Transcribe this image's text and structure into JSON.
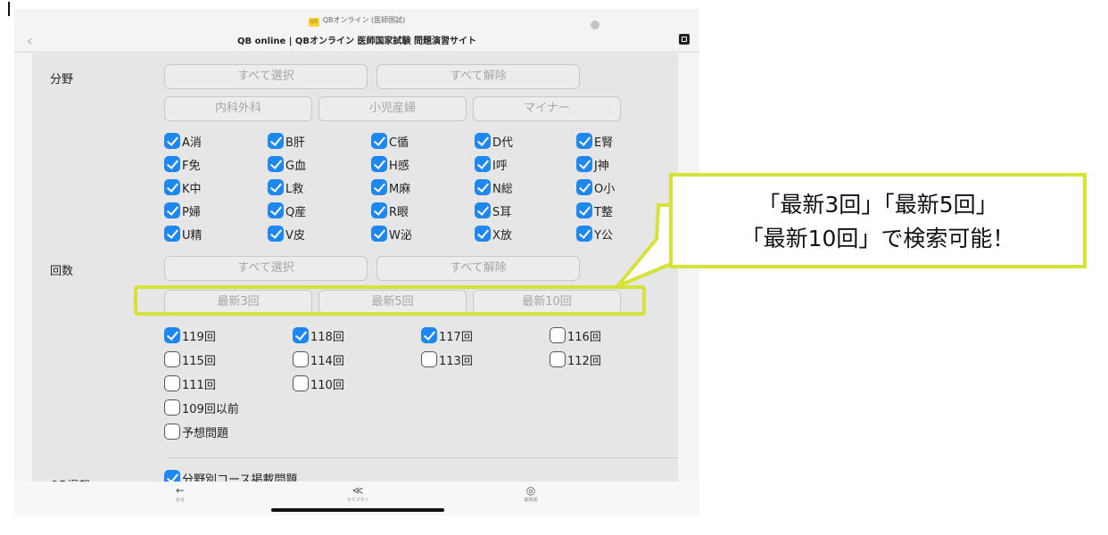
{
  "browser": {
    "status_title": "QBオンライン (医師国試)",
    "app_badge": "QB",
    "page_title": "QB online | QBオンライン 医師国家試験 問題演習サイト",
    "back_glyph": "‹"
  },
  "bunya": {
    "label": "分野",
    "select_all": "すべて選択",
    "deselect_all": "すべて解除",
    "groups": [
      "内科外科",
      "小児産婦",
      "マイナー"
    ],
    "items": [
      {
        "label": "A消",
        "checked": true
      },
      {
        "label": "B肝",
        "checked": true
      },
      {
        "label": "C循",
        "checked": true
      },
      {
        "label": "D代",
        "checked": true
      },
      {
        "label": "E腎",
        "checked": true
      },
      {
        "label": "F免",
        "checked": true
      },
      {
        "label": "G血",
        "checked": true
      },
      {
        "label": "H感",
        "checked": true
      },
      {
        "label": "I呼",
        "checked": true
      },
      {
        "label": "J神",
        "checked": true
      },
      {
        "label": "K中",
        "checked": true
      },
      {
        "label": "L救",
        "checked": true
      },
      {
        "label": "M麻",
        "checked": true
      },
      {
        "label": "N総",
        "checked": true
      },
      {
        "label": "O小",
        "checked": true
      },
      {
        "label": "P婦",
        "checked": true
      },
      {
        "label": "Q産",
        "checked": true
      },
      {
        "label": "R眼",
        "checked": true
      },
      {
        "label": "S耳",
        "checked": true
      },
      {
        "label": "T整",
        "checked": true
      },
      {
        "label": "U精",
        "checked": true
      },
      {
        "label": "V皮",
        "checked": true
      },
      {
        "label": "W泌",
        "checked": true
      },
      {
        "label": "X放",
        "checked": true
      },
      {
        "label": "Y公",
        "checked": true
      }
    ]
  },
  "kaisu": {
    "label": "回数",
    "select_all": "すべて選択",
    "deselect_all": "すべて解除",
    "recent": [
      "最新3回",
      "最新5回",
      "最新10回"
    ],
    "items": [
      {
        "label": "119回",
        "checked": true
      },
      {
        "label": "118回",
        "checked": true
      },
      {
        "label": "117回",
        "checked": true
      },
      {
        "label": "116回",
        "checked": false
      },
      {
        "label": "115回",
        "checked": false
      },
      {
        "label": "114回",
        "checked": false
      },
      {
        "label": "113回",
        "checked": false
      },
      {
        "label": "112回",
        "checked": false
      },
      {
        "label": "111回",
        "checked": false
      },
      {
        "label": "110回",
        "checked": false
      },
      {
        "label": "109回以前",
        "checked": false
      },
      {
        "label": "予想問題",
        "checked": false
      }
    ]
  },
  "qb": {
    "label": "QB掲載",
    "item": {
      "label": "分野別コース掲載問題",
      "checked": true
    }
  },
  "toolbar": {
    "back_label": "戻る",
    "library_label": "ライブラリ",
    "recent_label": "最新順"
  },
  "callout": {
    "line1": "「最新3回」「最新5回」",
    "line2": "「最新10回」で検索可能！"
  },
  "colors": {
    "highlight": "#d5e23a",
    "checkbox_on": "#1e88f0"
  }
}
